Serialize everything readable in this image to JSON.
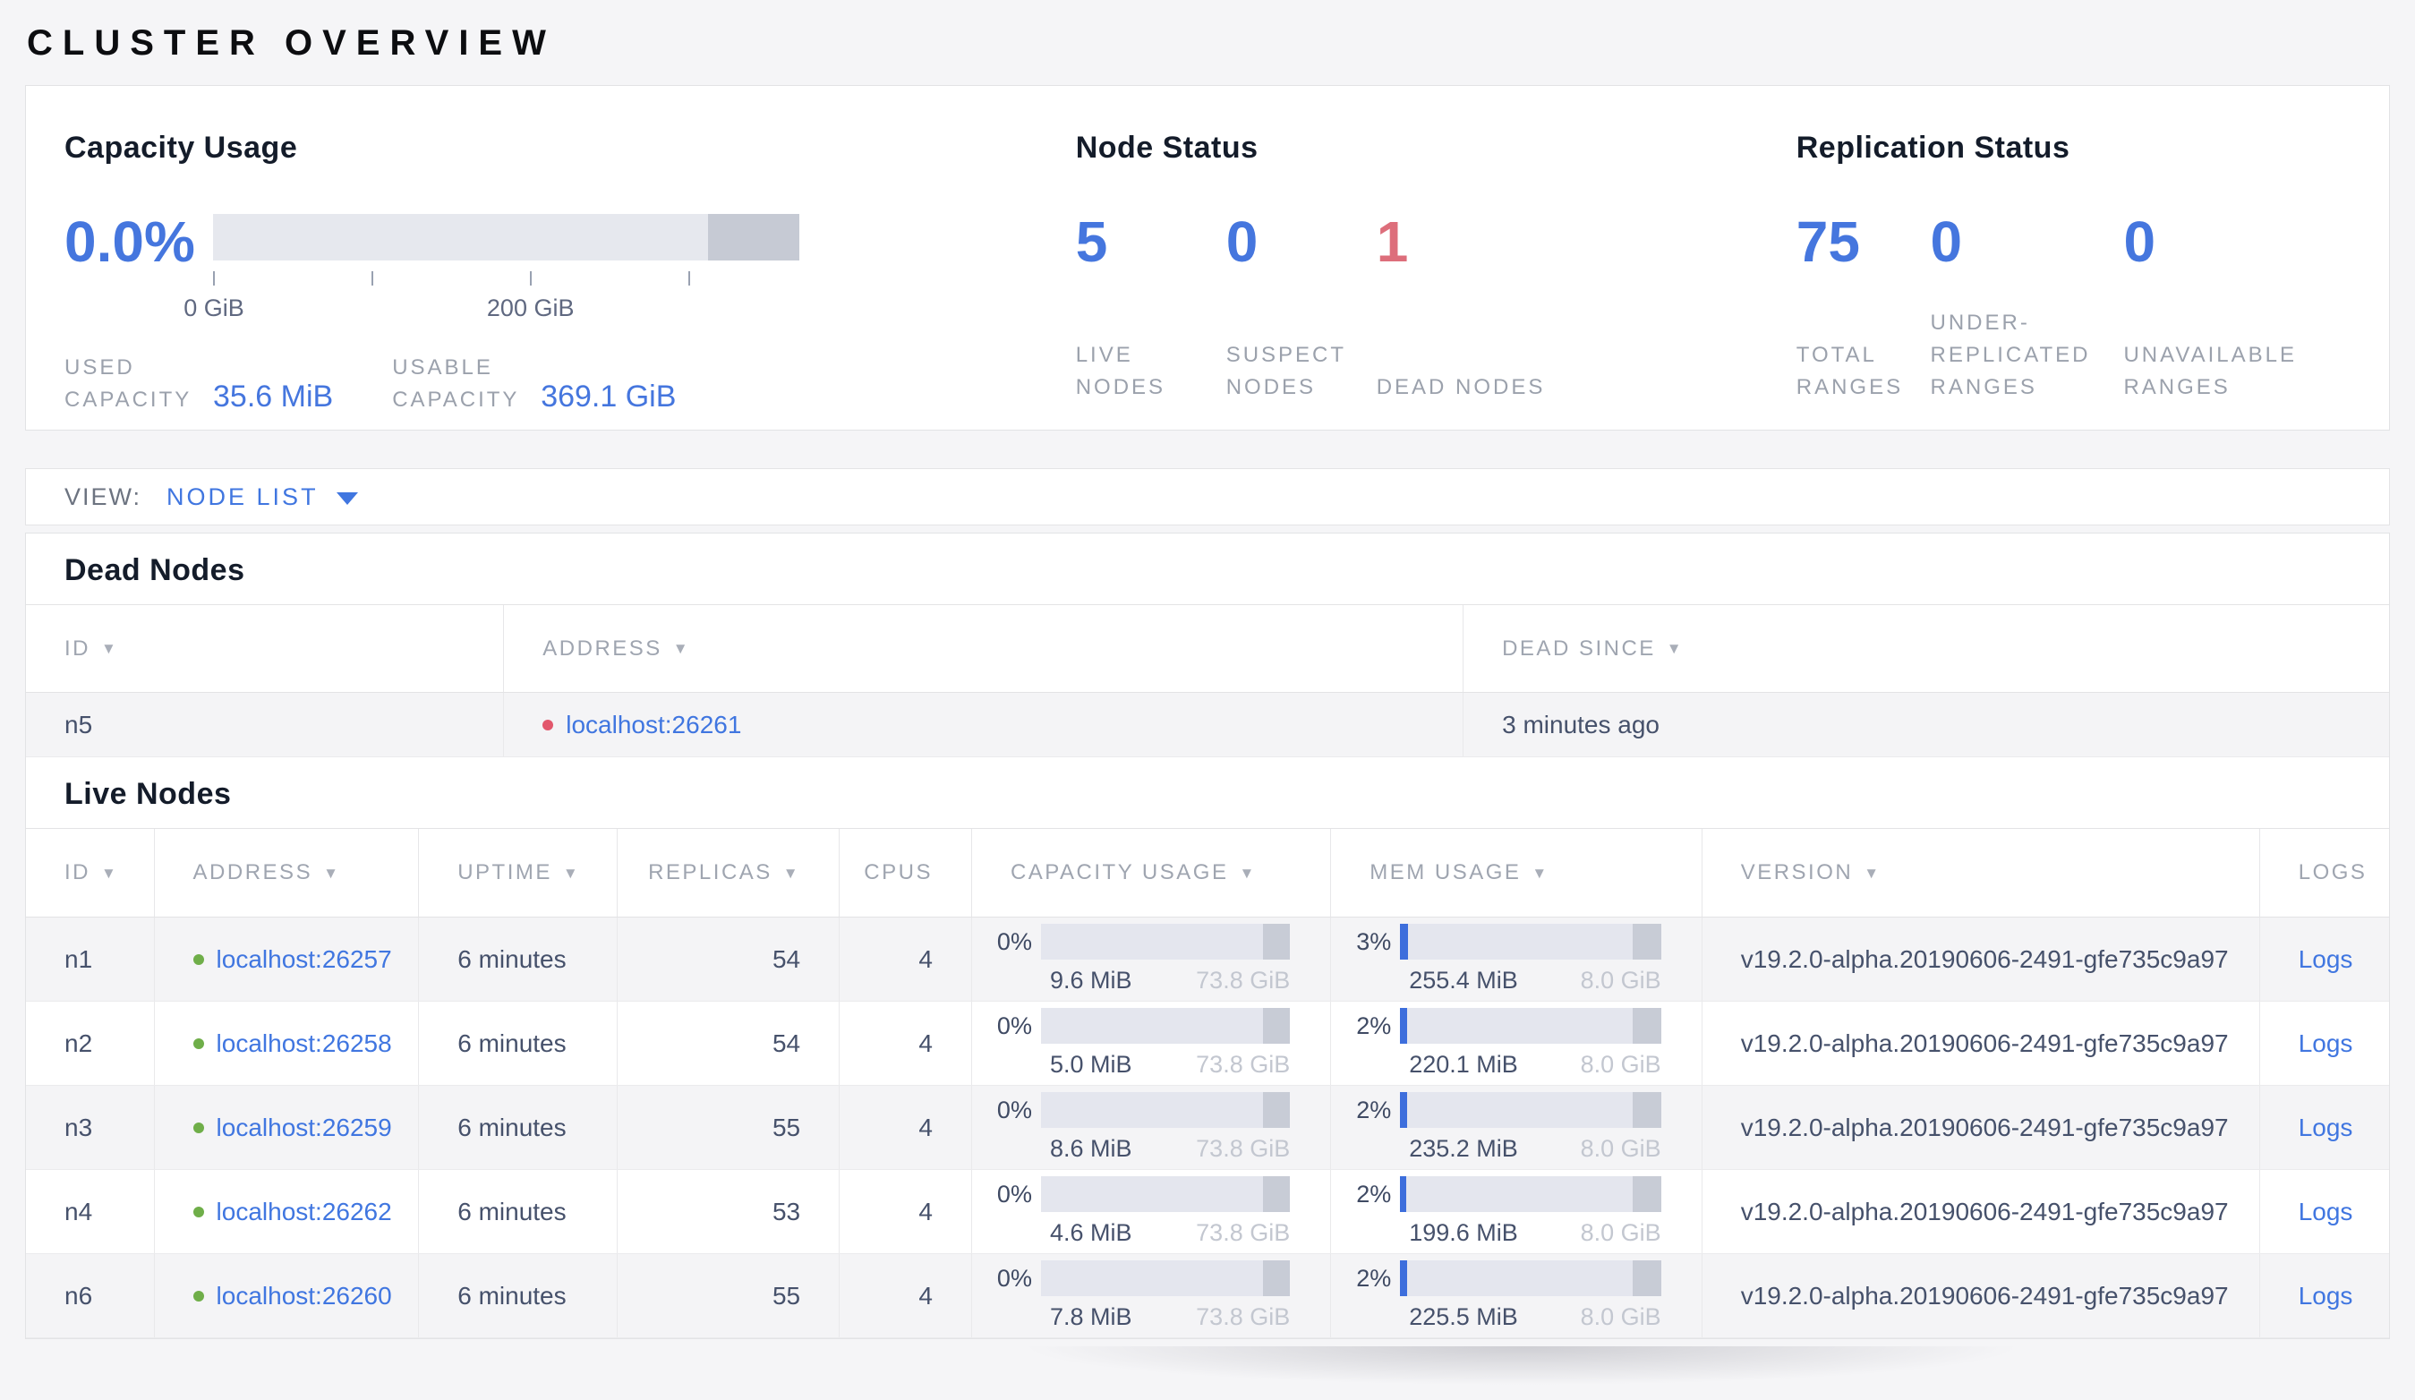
{
  "page": {
    "title": "CLUSTER OVERVIEW"
  },
  "capacity_panel": {
    "title": "Capacity Usage",
    "percent_used": "0.0%",
    "bar": {
      "reserved_pct": 15.5,
      "ticks": [
        {
          "pos": 0,
          "label": "0 GiB"
        },
        {
          "pos": 27,
          "label": ""
        },
        {
          "pos": 54,
          "label": "200 GiB"
        },
        {
          "pos": 81,
          "label": ""
        }
      ]
    },
    "stats": [
      {
        "label": "USED CAPACITY",
        "value": "35.6 MiB"
      },
      {
        "label": "USABLE CAPACITY",
        "value": "369.1 GiB"
      }
    ]
  },
  "node_status_panel": {
    "title": "Node Status",
    "stats": [
      {
        "value": "5",
        "label": "LIVE NODES"
      },
      {
        "value": "0",
        "label": "SUSPECT NODES"
      },
      {
        "value": "1",
        "label": "DEAD NODES"
      }
    ]
  },
  "replication_panel": {
    "title": "Replication Status",
    "stats": [
      {
        "value": "75",
        "label": "TOTAL RANGES"
      },
      {
        "value": "0",
        "label": "UNDER-REPLICATED RANGES"
      },
      {
        "value": "0",
        "label": "UNAVAILABLE RANGES"
      }
    ]
  },
  "view_bar": {
    "label": "VIEW:",
    "selected": "NODE LIST"
  },
  "dead_nodes": {
    "title": "Dead Nodes",
    "columns": [
      {
        "label": "ID"
      },
      {
        "label": "ADDRESS"
      },
      {
        "label": "DEAD SINCE"
      }
    ],
    "rows": [
      {
        "id": "n5",
        "address": "localhost:26261",
        "dead_since": "3 minutes ago"
      }
    ]
  },
  "live_nodes": {
    "title": "Live Nodes",
    "columns": [
      {
        "label": "ID"
      },
      {
        "label": "ADDRESS"
      },
      {
        "label": "UPTIME"
      },
      {
        "label": "REPLICAS"
      },
      {
        "label": "CPUS"
      },
      {
        "label": "CAPACITY USAGE"
      },
      {
        "label": "MEM USAGE"
      },
      {
        "label": "VERSION"
      },
      {
        "label": "LOGS"
      }
    ],
    "logs_label": "Logs",
    "rows": [
      {
        "id": "n1",
        "address": "localhost:26257",
        "uptime": "6 minutes",
        "replicas": "54",
        "cpus": "4",
        "capacity": {
          "pct": "0%",
          "fill": 0,
          "used": "9.6 MiB",
          "total": "73.8 GiB"
        },
        "memory": {
          "pct": "3%",
          "fill": 3,
          "used": "255.4 MiB",
          "total": "8.0 GiB"
        },
        "version": "v19.2.0-alpha.20190606-2491-gfe735c9a97"
      },
      {
        "id": "n2",
        "address": "localhost:26258",
        "uptime": "6 minutes",
        "replicas": "54",
        "cpus": "4",
        "capacity": {
          "pct": "0%",
          "fill": 0,
          "used": "5.0 MiB",
          "total": "73.8 GiB"
        },
        "memory": {
          "pct": "2%",
          "fill": 2.5,
          "used": "220.1 MiB",
          "total": "8.0 GiB"
        },
        "version": "v19.2.0-alpha.20190606-2491-gfe735c9a97"
      },
      {
        "id": "n3",
        "address": "localhost:26259",
        "uptime": "6 minutes",
        "replicas": "55",
        "cpus": "4",
        "capacity": {
          "pct": "0%",
          "fill": 0,
          "used": "8.6 MiB",
          "total": "73.8 GiB"
        },
        "memory": {
          "pct": "2%",
          "fill": 2.7,
          "used": "235.2 MiB",
          "total": "8.0 GiB"
        },
        "version": "v19.2.0-alpha.20190606-2491-gfe735c9a97"
      },
      {
        "id": "n4",
        "address": "localhost:26262",
        "uptime": "6 minutes",
        "replicas": "53",
        "cpus": "4",
        "capacity": {
          "pct": "0%",
          "fill": 0,
          "used": "4.6 MiB",
          "total": "73.8 GiB"
        },
        "memory": {
          "pct": "2%",
          "fill": 2.3,
          "used": "199.6 MiB",
          "total": "8.0 GiB"
        },
        "version": "v19.2.0-alpha.20190606-2491-gfe735c9a97"
      },
      {
        "id": "n6",
        "address": "localhost:26260",
        "uptime": "6 minutes",
        "replicas": "55",
        "cpus": "4",
        "capacity": {
          "pct": "0%",
          "fill": 0,
          "used": "7.8 MiB",
          "total": "73.8 GiB"
        },
        "memory": {
          "pct": "2%",
          "fill": 2.6,
          "used": "225.5 MiB",
          "total": "8.0 GiB"
        },
        "version": "v19.2.0-alpha.20190606-2491-gfe735c9a97"
      }
    ]
  }
}
